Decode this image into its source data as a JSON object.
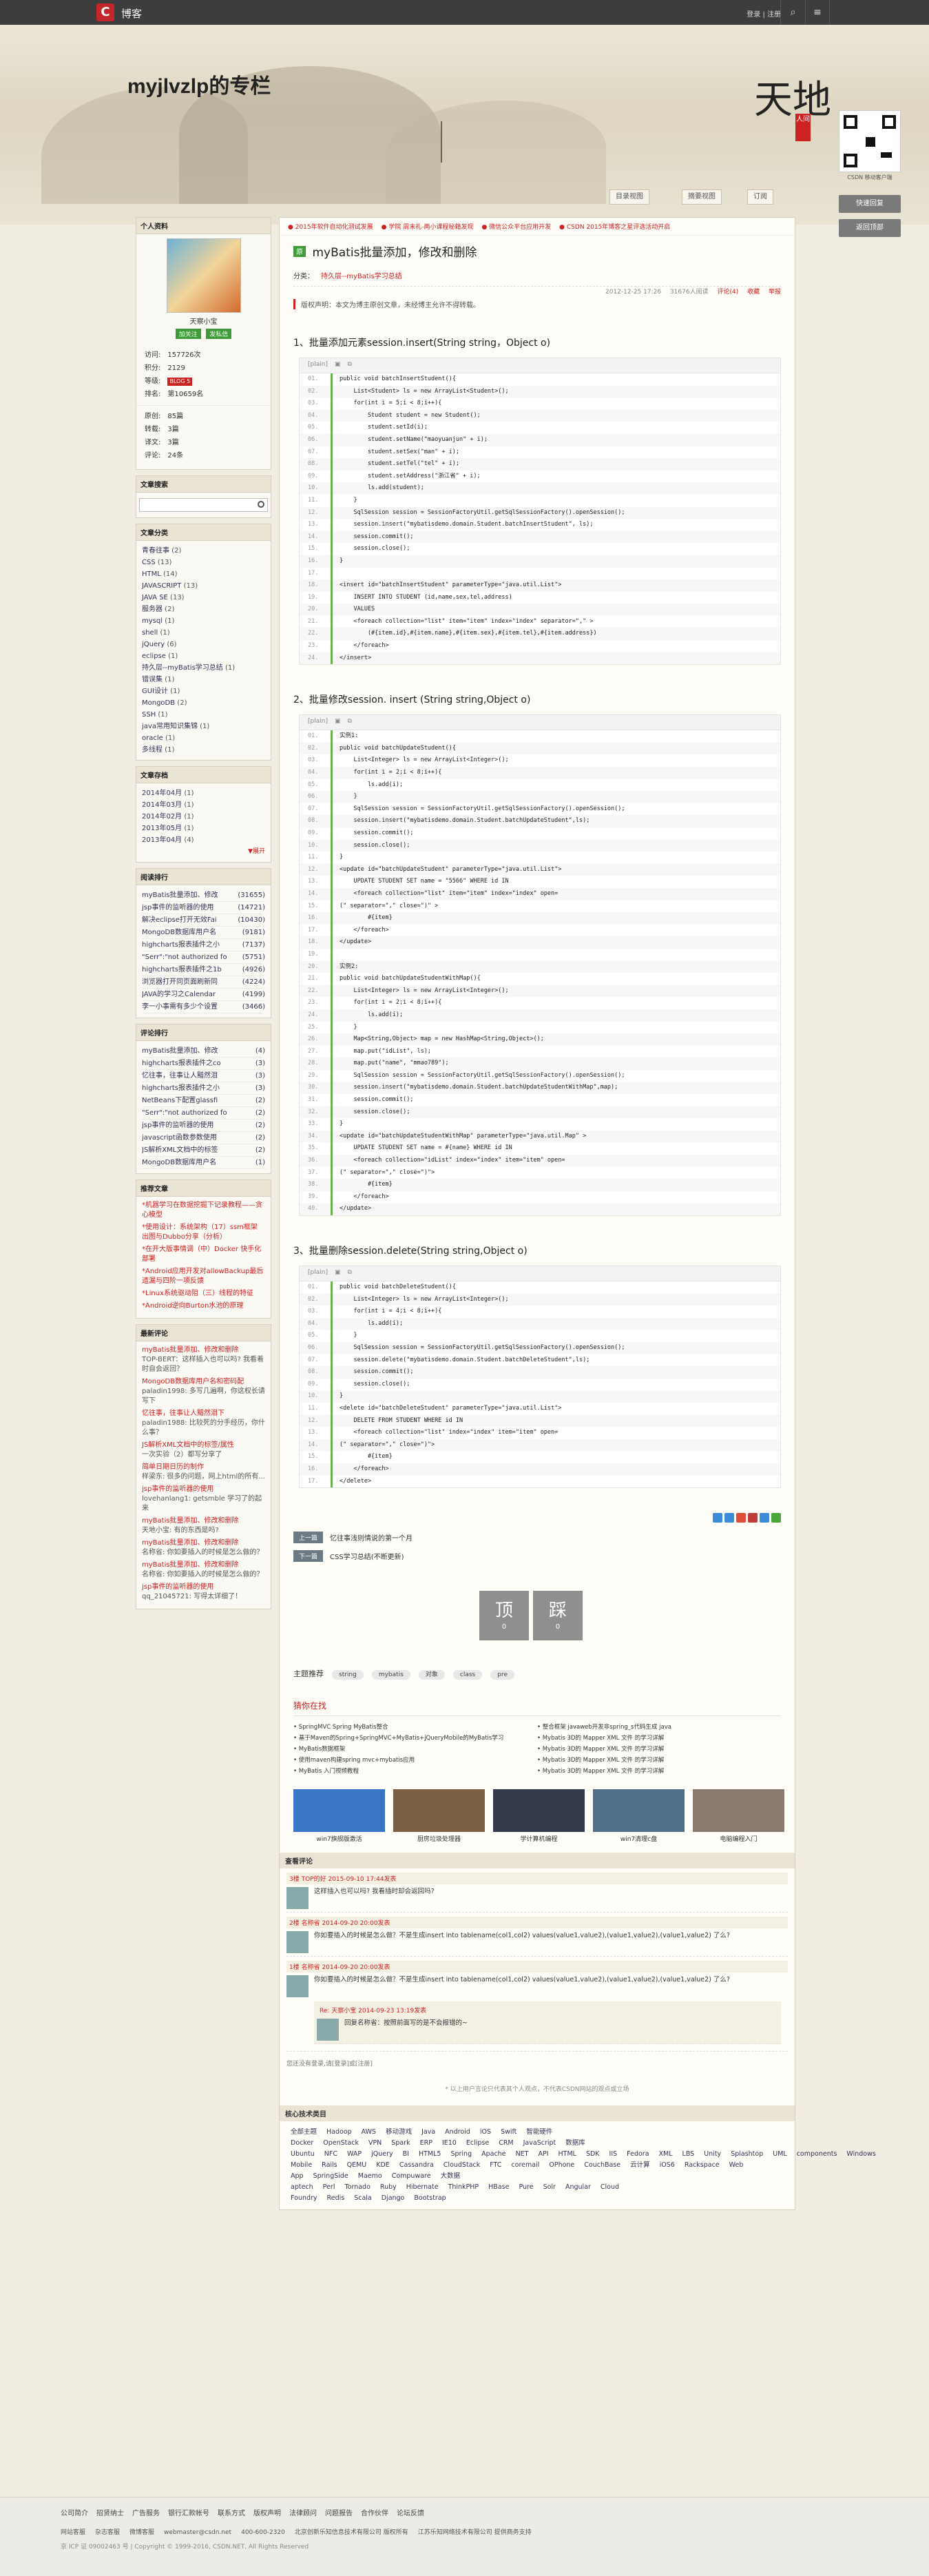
{
  "topbar": {
    "brand": "博客",
    "login": "登录 | 注册",
    "search_icon": "search-icon",
    "menu_icon": "menu-icon"
  },
  "banner": {
    "title": "myjlvzlp的专栏",
    "calligraphy": "天地",
    "seal": "人间",
    "qr_caption": "CSDN 移动客户端"
  },
  "side_buttons": {
    "feedback": "快速回复",
    "top": "返回顶部"
  },
  "view_buttons": {
    "list": "目录视图",
    "summary": "摘要视图",
    "rss": "订阅"
  },
  "profile": {
    "header": "个人资料",
    "name": "天察小宝",
    "follow": "加关注",
    "message": "发私信",
    "stats": [
      {
        "k": "访问:",
        "v": "157726次"
      },
      {
        "k": "积分:",
        "v": "2129"
      },
      {
        "k": "等级:",
        "v": "BLOG 5"
      },
      {
        "k": "排名:",
        "v": "第10659名"
      }
    ],
    "stats2": [
      {
        "k": "原创:",
        "v": "85篇"
      },
      {
        "k": "转载:",
        "v": "3篇"
      },
      {
        "k": "译文:",
        "v": "3篇"
      },
      {
        "k": "评论:",
        "v": "24条"
      }
    ]
  },
  "search": {
    "header": "文章搜索"
  },
  "categories": {
    "header": "文章分类",
    "items": [
      {
        "n": "青春往事",
        "c": "(2)"
      },
      {
        "n": "CSS",
        "c": "(13)"
      },
      {
        "n": "HTML",
        "c": "(14)"
      },
      {
        "n": "JAVASCRIPT",
        "c": "(13)"
      },
      {
        "n": "JAVA SE",
        "c": "(13)"
      },
      {
        "n": "服务器",
        "c": "(2)"
      },
      {
        "n": "mysql",
        "c": "(1)"
      },
      {
        "n": "shell",
        "c": "(1)"
      },
      {
        "n": "jQuery",
        "c": "(6)"
      },
      {
        "n": "eclipse",
        "c": "(1)"
      },
      {
        "n": "持久层--myBatis学习总结",
        "c": "(1)"
      },
      {
        "n": "错误集",
        "c": "(1)"
      },
      {
        "n": "GUI设计",
        "c": "(1)"
      },
      {
        "n": "MongoDB",
        "c": "(2)"
      },
      {
        "n": "SSH",
        "c": "(1)"
      },
      {
        "n": "java常用知识集锦",
        "c": "(1)"
      },
      {
        "n": "oracle",
        "c": "(1)"
      },
      {
        "n": "多线程",
        "c": "(1)"
      }
    ]
  },
  "archive": {
    "header": "文章存档",
    "items": [
      {
        "n": "2014年04月",
        "c": "(1)"
      },
      {
        "n": "2014年03月",
        "c": "(1)"
      },
      {
        "n": "2014年02月",
        "c": "(1)"
      },
      {
        "n": "2013年05月",
        "c": "(1)"
      },
      {
        "n": "2013年04月",
        "c": "(4)"
      }
    ],
    "more": "展开"
  },
  "reads": {
    "header": "阅读排行",
    "items": [
      {
        "n": "myBatis批量添加、修改",
        "c": "(31655)"
      },
      {
        "n": "jsp事件的监听器的使用",
        "c": "(14721)"
      },
      {
        "n": "解决eclipse打开无效Fai",
        "c": "(10430)"
      },
      {
        "n": "MongoDB数据库用户名",
        "c": "(9181)"
      },
      {
        "n": "highcharts报表插件之小",
        "c": "(7137)"
      },
      {
        "n": "\"Serr\":\"not authorized fo",
        "c": "(5751)"
      },
      {
        "n": "highcharts报表插件之1b",
        "c": "(4926)"
      },
      {
        "n": "浏览器打开同页面刷新同",
        "c": "(4224)"
      },
      {
        "n": "JAVA的学习之Calendar",
        "c": "(4199)"
      },
      {
        "n": "李一小事需有多少个设置",
        "c": "(3466)"
      }
    ]
  },
  "comments_rank": {
    "header": "评论排行",
    "items": [
      {
        "n": "myBatis批量添加、修改",
        "c": "(4)"
      },
      {
        "n": "highcharts报表插件之co",
        "c": "(3)"
      },
      {
        "n": "忆往事，往事让人黯然泪",
        "c": "(3)"
      },
      {
        "n": "highcharts报表插件之小",
        "c": "(3)"
      },
      {
        "n": "NetBeans下配置glassfi",
        "c": "(2)"
      },
      {
        "n": "\"Serr\":\"not authorized fo",
        "c": "(2)"
      },
      {
        "n": "jsp事件的监听器的使用",
        "c": "(2)"
      },
      {
        "n": "javascript函数参数使用",
        "c": "(2)"
      },
      {
        "n": "JS解析XML文档中的标签",
        "c": "(2)"
      },
      {
        "n": "MongoDB数据库用户名",
        "c": "(1)"
      }
    ]
  },
  "recommend": {
    "header": "推荐文章",
    "items": [
      "*机器学习在数据挖掘下记录教程——贪心模型",
      "*使用设计：系统架构（17）ssm框架 出图与Dubbo分享（分析）",
      "*在开大版事情调（中）Docker 快手化部署",
      "*Android应用开发对allowBackup最后遗漏与四阶一项反馈",
      "*Linux系统驱动阻（三）线程的特征",
      "*Android逆向Burton水池的原理"
    ]
  },
  "latest": {
    "header": "最新评论",
    "items": [
      {
        "t": "myBatis批量添加、修改和删除",
        "b": "TOP-BERT：这样插入也可以吗? 我看着时自会返回？"
      },
      {
        "t": "MongoDB数据库用户名和密码配",
        "b": "paladin1998: 多写几遍啊，你这权长请写下"
      },
      {
        "t": "忆往事，往事让人黯然泪下",
        "b": "paladin1988: 比较死的分手经历，你什么事？"
      },
      {
        "t": "JS解析XML文档中的标签/属性",
        "b": "一次实验（2）都写分享了"
      },
      {
        "t": "简单日期日历的制作",
        "b": "样梁东: 很多的问题，网上html的所有..."
      },
      {
        "t": "jsp事件的监听器的使用",
        "b": "lovehanlang1: getsmble 学习了的起来"
      },
      {
        "t": "myBatis批量添加、修改和删除",
        "b": "天地小宝: 有的东西是吗?"
      },
      {
        "t": "myBatis批量添加、修改和删除",
        "b": "名称省: 你如要插入的时候是怎么做的？"
      },
      {
        "t": "myBatis批量添加、修改和删除",
        "b": "名称省: 你如要插入的时候是怎么做的？"
      },
      {
        "t": "jsp事件的监听器的使用",
        "b": "qq_21045721: 写得太详细了！"
      }
    ]
  },
  "notice": [
    "2015年软件自动化测试发展",
    "学院 周末礼-两小课程秘籍发现",
    "微信公众平台应用开发",
    "CSDN 2015年博客之星评选活动开启"
  ],
  "article": {
    "tag": "原",
    "title": "myBatis批量添加，修改和删除",
    "date": "2012-12-25 17:26",
    "reads": "31676人阅读",
    "comments": "评论(4)",
    "fav": "收藏",
    "report": "举报",
    "cat_label": "分类：",
    "cat_value": "持久层--myBatis学习总结",
    "copyright": "版权声明：本文为博主原创文章，未经博主允许不得转载。",
    "code_toolbar": "[plain]",
    "s1": "1、批量添加元素session.insert(String string，Object o)",
    "s2": "2、批量修改session. insert (String string,Object o)",
    "s3": "3、批量删除session.delete(String string,Object o)",
    "code1": [
      "public void batchInsertStudent(){",
      "    List<Student> ls = new ArrayList<Student>();",
      "    for(int i = 5;i < 8;i++){",
      "        Student student = new Student();",
      "        student.setId(i);",
      "        student.setName(\"maoyuanjun\" + i);",
      "        student.setSex(\"man\" + i);",
      "        student.setTel(\"tel\" + i);",
      "        student.setAddress(\"浙江省\" + i);",
      "        ls.add(student);",
      "    }",
      "    SqlSession session = SessionFactoryUtil.getSqlSessionFactory().openSession();",
      "    session.insert(\"mybatisdemo.domain.Student.batchInsertStudent\", ls);",
      "    session.commit();",
      "    session.close();",
      "}",
      "",
      "<insert id=\"batchInsertStudent\" parameterType=\"java.util.List\">",
      "    INSERT INTO STUDENT (id,name,sex,tel,address)",
      "    VALUES",
      "    <foreach collection=\"list\" item=\"item\" index=\"index\" separator=\",\" >",
      "        (#{item.id},#{item.name},#{item.sex},#{item.tel},#{item.address})",
      "    </foreach>",
      "</insert>"
    ],
    "code2": [
      "实例1:",
      "public void batchUpdateStudent(){",
      "    List<Integer> ls = new ArrayList<Integer>();",
      "    for(int i = 2;i < 8;i++){",
      "        ls.add(i);",
      "    }",
      "    SqlSession session = SessionFactoryUtil.getSqlSessionFactory().openSession();",
      "    session.insert(\"mybatisdemo.domain.Student.batchUpdateStudent\",ls);",
      "    session.commit();",
      "    session.close();",
      "}",
      "<update id=\"batchUpdateStudent\" parameterType=\"java.util.List\">",
      "    UPDATE STUDENT SET name = \"5566\" WHERE id IN",
      "    <foreach collection=\"list\" item=\"item\" index=\"index\" open=",
      "(\" separator=\",\" close=\")\" >",
      "        #{item}",
      "    </foreach>",
      "</update>",
      "",
      "实例2:",
      "public void batchUpdateStudentWithMap(){",
      "    List<Integer> ls = new ArrayList<Integer>();",
      "    for(int i = 2;i < 8;i++){",
      "        ls.add(i);",
      "    }",
      "    Map<String,Object> map = new HashMap<String,Object>();",
      "    map.put(\"idList\", ls);",
      "    map.put(\"name\", \"mmao789\");",
      "    SqlSession session = SessionFactoryUtil.getSqlSessionFactory().openSession();",
      "    session.insert(\"mybatisdemo.domain.Student.batchUpdateStudentWithMap\",map);",
      "    session.commit();",
      "    session.close();",
      "}",
      "<update id=\"batchUpdateStudentWithMap\" parameterType=\"java.util.Map\" >",
      "    UPDATE STUDENT SET name = #{name} WHERE id IN",
      "    <foreach collection=\"idList\" index=\"index\" item=\"item\" open=",
      "(\" separator=\",\" close=\")\">",
      "        #{item}",
      "    </foreach>",
      "</update>"
    ],
    "code3": [
      "public void batchDeleteStudent(){",
      "    List<Integer> ls = new ArrayList<Integer>();",
      "    for(int i = 4;i < 8;i++){",
      "        ls.add(i);",
      "    }",
      "    SqlSession session = SessionFactoryUtil.getSqlSessionFactory().openSession();",
      "    session.delete(\"mybatisdemo.domain.Student.batchDeleteStudent\",ls);",
      "    session.commit();",
      "    session.close();",
      "}",
      "<delete id=\"batchDeleteStudent\" parameterType=\"java.util.List\">",
      "    DELETE FROM STUDENT WHERE id IN",
      "    <foreach collection=\"list\" index=\"index\" item=\"item\" open=",
      "(\" separator=\",\" close=\")\">",
      "        #{item}",
      "    </foreach>",
      "</delete>"
    ]
  },
  "nav": {
    "prev_btn": "上一篇",
    "prev": "忆往事浅则情说的第一个月",
    "next_btn": "下一篇",
    "next": "CSS学习总结(不断更新)"
  },
  "vote": {
    "up": "顶",
    "up_count": "0",
    "down": "踩",
    "down_count": "0"
  },
  "topics": {
    "label": "主题推荐",
    "tags": [
      "string",
      "mybatis",
      "对象",
      "class",
      "pre"
    ]
  },
  "guess": {
    "header": "猜你在找",
    "items": [
      "SpringMVC Spring MyBatis整合",
      "整合框架 javaweb开发非spring_s代码生成 java",
      "基于Maven的Spring+SpringMVC+MyBatis+jQueryMobile的MyBatis学习",
      "Mybatis 3D的 Mapper XML 文件 的学习详解",
      "MyBatis数据框架",
      "Mybatis 3D的 Mapper XML 文件 的学习详解",
      "使用maven构建spring mvc+mybatis应用",
      "Mybatis 3D的 Mapper XML 文件 的学习详解",
      "MyBatis 入门视频教程",
      "Mybatis 3D的 Mapper XML 文件 的学习详解"
    ]
  },
  "thumbs": [
    {
      "c": "win7旗舰版激活",
      "col": "#3a74c4"
    },
    {
      "c": "厨房垃圾处理器",
      "col": "#7b5f44"
    },
    {
      "c": "学计算机编程",
      "col": "#333a4a"
    },
    {
      "c": "win7清理c盘",
      "col": "#4f6e8a"
    },
    {
      "c": "电脑编程入门",
      "col": "#8a7a70"
    }
  ],
  "comments": {
    "header": "查看评论",
    "items": [
      {
        "who": "3楼 TOP的好 2015-09-10 17:44发表",
        "text": "这样插入也可以吗? 我看插时却会返回吗?"
      },
      {
        "who": "2楼 名称省 2014-09-20 20:00发表",
        "text": "你如要插入的时候是怎么做？不是生成insert into tablename(col1,col2) values(value1,value2),(value1,value2),(value1,value2) 了么?"
      },
      {
        "who": "1楼 名称省 2014-09-20 20:00发表",
        "text": "你如要插入的时候是怎么做？不是生成insert into tablename(col1,col2) values(value1,value2),(value1,value2),(value1,value2) 了么?"
      }
    ],
    "reply_who": "Re: 天察小宝 2014-09-23 13:19发表",
    "reply_text": "回复名称省：按照前面写的是不会报错的~",
    "no_more": "您还没有登录,请[登录]或[注册]",
    "disclaimer": "* 以上用户言论只代表其个人观点，不代表CSDN网站的观点或立场"
  },
  "tech": {
    "header": "核心技术类目",
    "words": [
      "全部主题",
      "Hadoop",
      "AWS",
      "移动游戏",
      "Java",
      "Android",
      "iOS",
      "Swift",
      "智能硬件",
      "Docker",
      "OpenStack",
      "VPN",
      "Spark",
      "ERP",
      "IE10",
      "Eclipse",
      "CRM",
      "JavaScript",
      "数据库",
      "Ubuntu",
      "NFC",
      "WAP",
      "jQuery",
      "BI",
      "HTML5",
      "Spring",
      "Apache",
      "NET",
      "API",
      "HTML",
      "SDK",
      "IIS",
      "Fedora",
      "XML",
      "LBS",
      "Unity",
      "Splashtop",
      "UML",
      "components",
      "Windows Mobile",
      "Rails",
      "QEMU",
      "KDE",
      "Cassandra",
      "CloudStack",
      "FTC",
      "coremail",
      "OPhone",
      "CouchBase",
      "云计算",
      "iOS6",
      "Rackspace",
      "Web App",
      "SpringSide",
      "Maemo",
      "Compuware",
      "大数据",
      "aptech",
      "Perl",
      "Tornado",
      "Ruby",
      "Hibernate",
      "ThinkPHP",
      "HBase",
      "Pure",
      "Solr",
      "Angular",
      "Cloud Foundry",
      "Redis",
      "Scala",
      "Django",
      "Bootstrap"
    ]
  },
  "footer": {
    "links": [
      "公司简介",
      "招贤纳士",
      "广告服务",
      "银行汇款帐号",
      "联系方式",
      "版权声明",
      "法律顾问",
      "问题报告",
      "合作伙伴",
      "论坛反馈"
    ],
    "contact": [
      "网站客服",
      "杂志客服",
      "微博客服",
      "webmaster@csdn.net",
      "400-600-2320",
      "北京创新乐知信息技术有限公司 版权所有",
      "江苏乐知网络技术有限公司 提供商务支持"
    ],
    "copyright": "京 ICP 证 09002463 号 | Copyright © 1999-2016, CSDN.NET, All Rights Reserved"
  }
}
